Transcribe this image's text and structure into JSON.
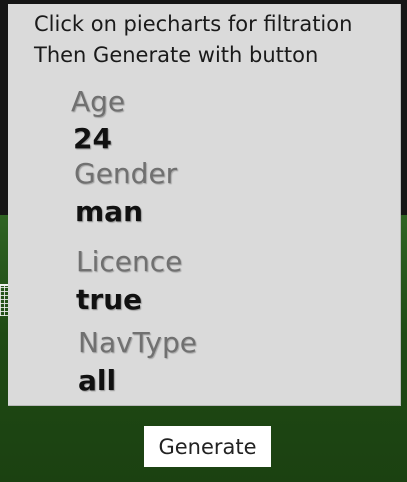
{
  "instructions": {
    "line1": "Click on piecharts for filtration",
    "line2": "Then Generate with button"
  },
  "filters": {
    "age": {
      "label": "Age",
      "value": "24"
    },
    "gender": {
      "label": "Gender",
      "value": "man"
    },
    "licence": {
      "label": "Licence",
      "value": "true"
    },
    "navtype": {
      "label": "NavType",
      "value": "all"
    }
  },
  "generate_button": {
    "label": "Generate"
  },
  "colors": {
    "panel": "#dadada",
    "label_text": "#707070",
    "value_text": "#111111",
    "field_green": "#1f4a13",
    "button_bg": "#ffffff"
  }
}
